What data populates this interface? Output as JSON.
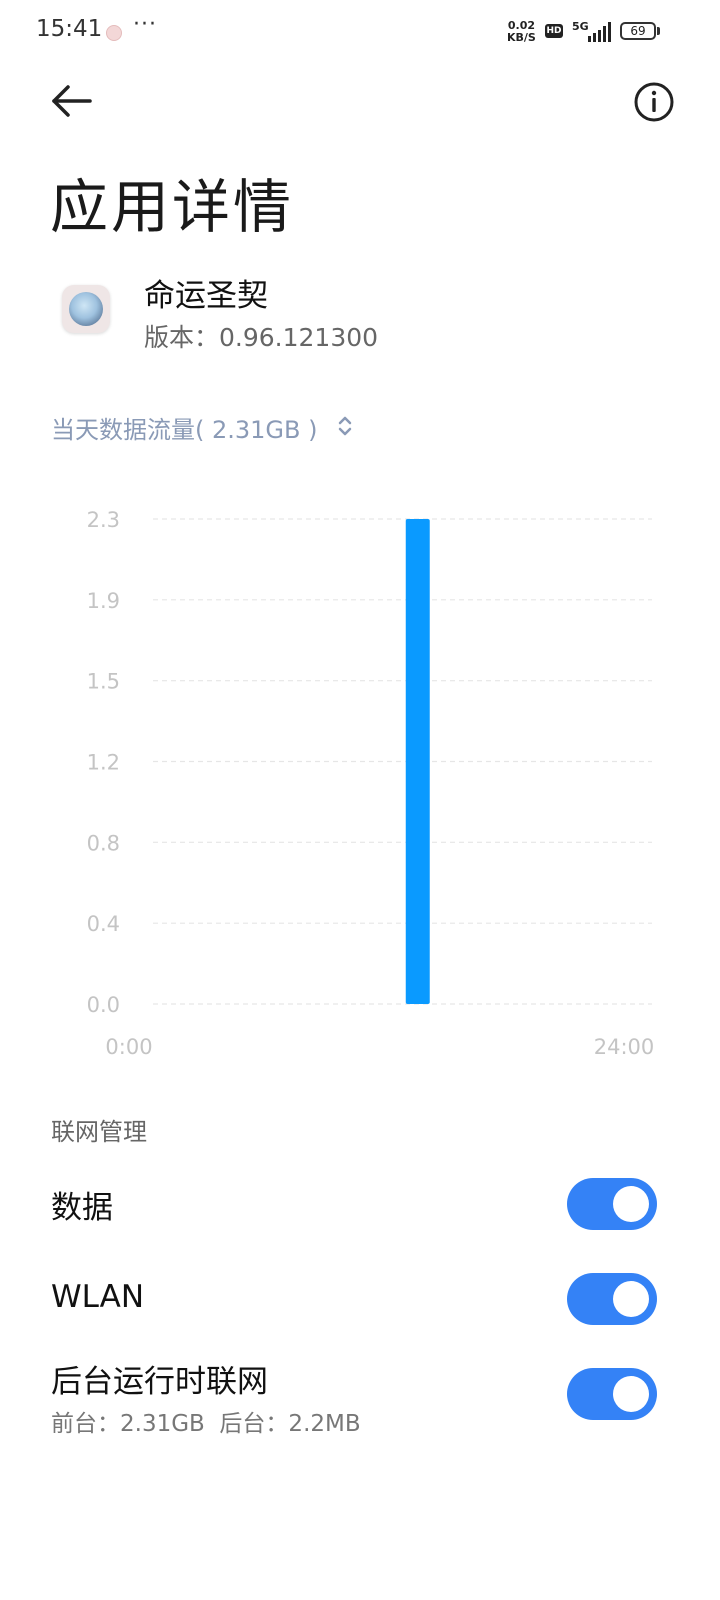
{
  "status_bar": {
    "time": "15:41",
    "more": "···",
    "net_speed_value": "0.02",
    "net_speed_unit": "KB/S",
    "hd": "HD",
    "network": "5G",
    "battery": "69"
  },
  "header": {
    "title": "应用详情",
    "back_icon": "arrow-left-icon",
    "info_icon": "info-circle-icon"
  },
  "app": {
    "name": "命运圣契",
    "version": "版本：0.96.121300"
  },
  "usage": {
    "label": "当天数据流量( 2.31GB )"
  },
  "chart_data": {
    "type": "bar",
    "title": "",
    "xlabel": "",
    "ylabel": "",
    "y_ticks": [
      "2.3",
      "1.9",
      "1.5",
      "1.2",
      "0.8",
      "0.4",
      "0.0"
    ],
    "ylim": [
      0,
      2.31
    ],
    "x_ticks": [
      "0:00",
      "24:00"
    ],
    "xlim": [
      0,
      24
    ],
    "bars": [
      {
        "x": 14,
        "value": 2.31
      }
    ],
    "bar_color": "#0a9aff",
    "grid": true
  },
  "network_management": {
    "section_title": "联网管理",
    "rows": [
      {
        "label": "数据",
        "enabled": true
      },
      {
        "label": "WLAN",
        "enabled": true
      },
      {
        "label": "后台运行时联网",
        "sub": "前台：2.31GB  后台：2.2MB",
        "enabled": true
      }
    ],
    "accent_color": "#3482f6"
  }
}
